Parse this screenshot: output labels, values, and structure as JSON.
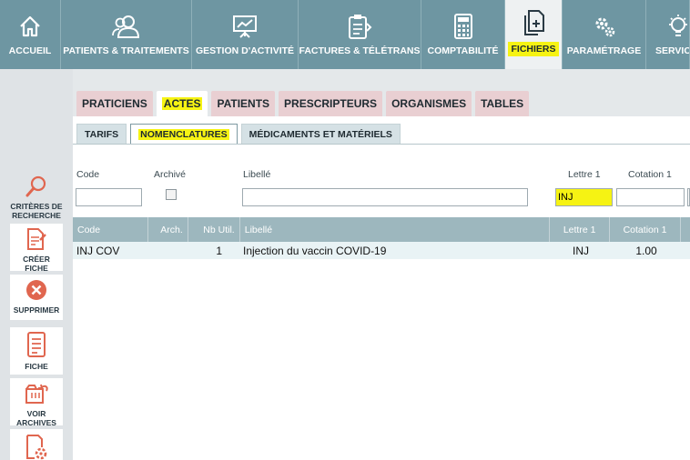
{
  "nav": {
    "items": [
      {
        "label": "ACCUEIL",
        "icon": "home-icon"
      },
      {
        "label": "PATIENTS & TRAITEMENTS",
        "icon": "users-icon"
      },
      {
        "label": "GESTION D'ACTIVITÉ",
        "icon": "chart-board-icon"
      },
      {
        "label": "FACTURES & TÉLÉTRANS",
        "icon": "clipboard-transfer-icon"
      },
      {
        "label": "COMPTABILITÉ",
        "icon": "calculator-icon"
      },
      {
        "label": "FICHIERS",
        "icon": "files-add-icon"
      },
      {
        "label": "PARAMÉTRAGE",
        "icon": "gears-icon"
      },
      {
        "label": "SERVICE",
        "icon": "lightbulb-icon"
      }
    ]
  },
  "rail": {
    "items": [
      {
        "line1": "CRITÈRES DE",
        "line2": "RECHERCHE",
        "icon": "search-icon"
      },
      {
        "line1": "CRÉER",
        "line2": "FICHE",
        "icon": "create-document-icon"
      },
      {
        "line1": "SUPPRIMER",
        "line2": "",
        "icon": "delete-icon"
      },
      {
        "line1": "FICHE",
        "line2": "",
        "icon": "document-icon"
      },
      {
        "line1": "VOIR",
        "line2": "ARCHIVES",
        "icon": "archive-folder-icon"
      },
      {
        "line1": "",
        "line2": "",
        "icon": "document-settings-icon"
      }
    ]
  },
  "tabs": {
    "level1": [
      "PRATICIENS",
      "ACTES",
      "PATIENTS",
      "PRESCRIPTEURS",
      "ORGANISMES",
      "TABLES"
    ],
    "level2": [
      "TARIFS",
      "NOMENCLATURES",
      "MÉDICAMENTS ET MATÉRIELS"
    ]
  },
  "filters": {
    "code_label": "Code",
    "archive_label": "Archivé",
    "libelle_label": "Libellé",
    "lettre1_label": "Lettre 1",
    "cotation1_label": "Cotation 1",
    "code_value": "",
    "libelle_value": "",
    "lettre1_value": "INJ",
    "cotation1_value": ""
  },
  "table": {
    "headers": [
      "Code",
      "Arch.",
      "Nb Util.",
      "Libellé",
      "Lettre 1",
      "Cotation 1"
    ],
    "rows": [
      {
        "code": "INJ COV",
        "arch": "",
        "nb_util": "1",
        "libelle": "Injection du vaccin COVID-19",
        "lettre1": "INJ",
        "cotation1": "1.00"
      }
    ]
  },
  "colors": {
    "nav_bg": "#6e96a2",
    "highlight": "#f6f313",
    "tab_pink": "#e9cfd2",
    "table_header": "#9db7be",
    "row_bg": "#e9f3f5"
  }
}
